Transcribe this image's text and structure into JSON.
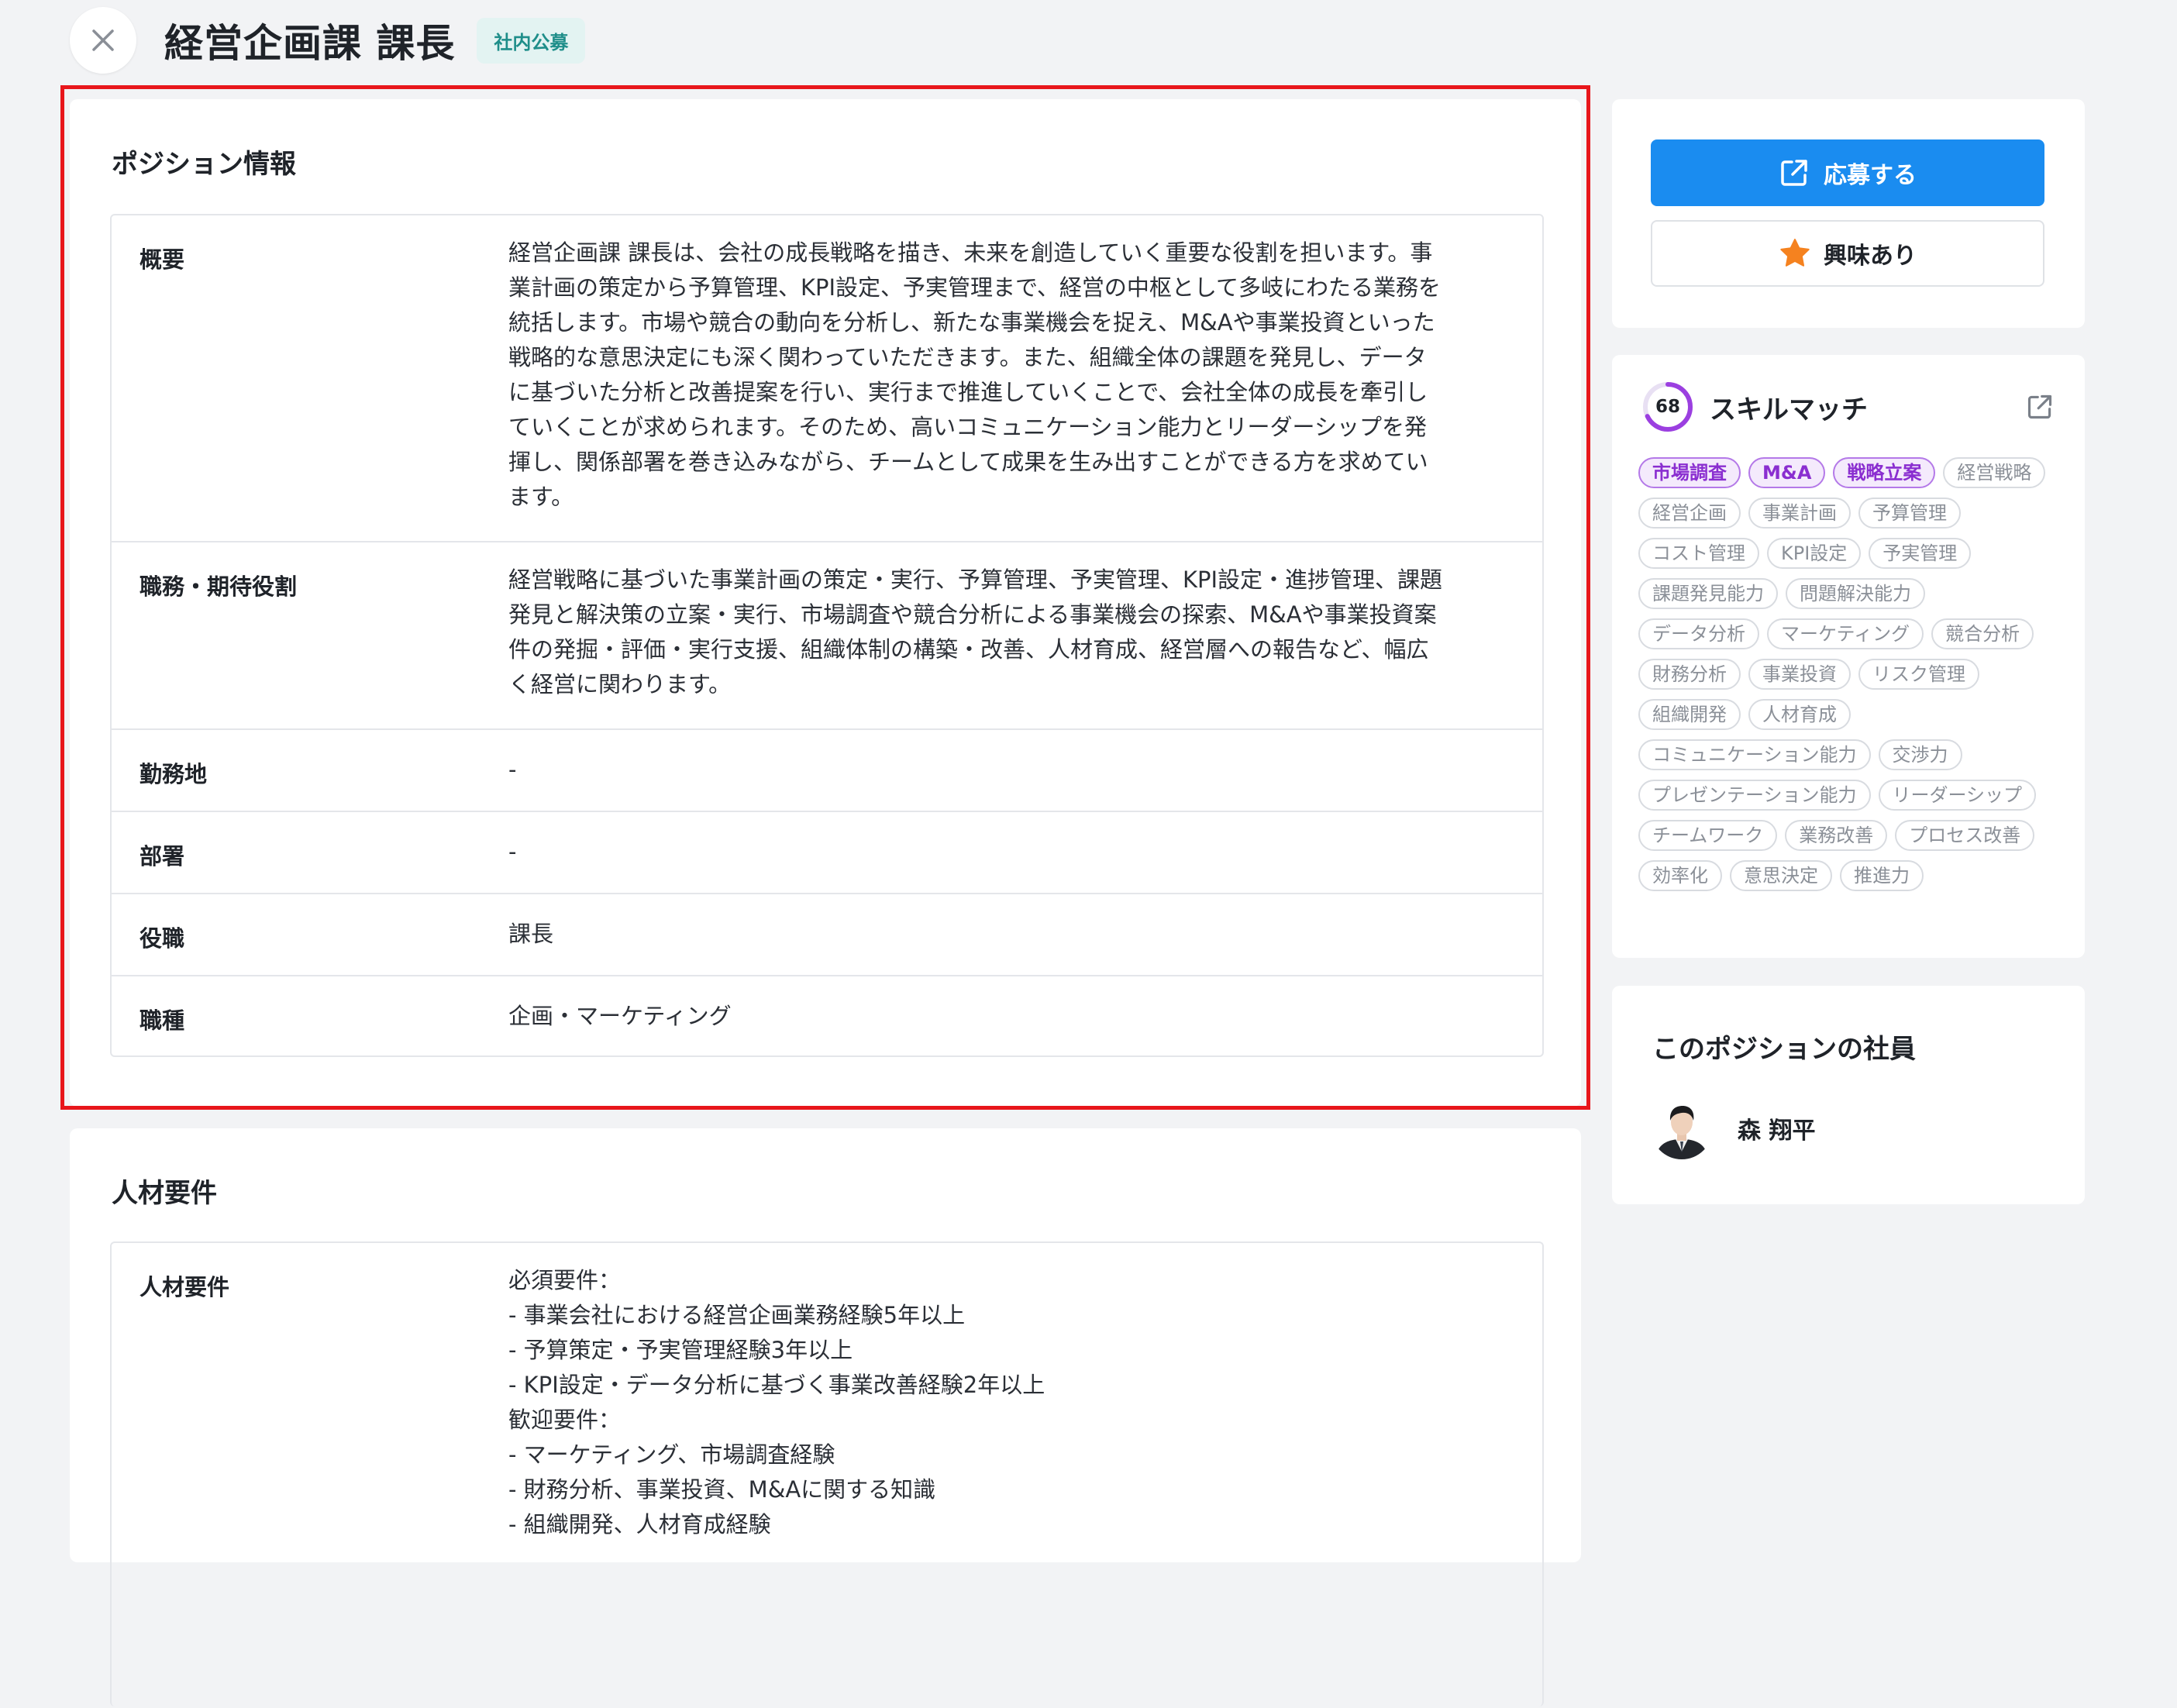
{
  "header": {
    "title": "経営企画課 課長",
    "badge": "社内公募"
  },
  "position_info": {
    "title": "ポジション情報",
    "rows": [
      {
        "label": "概要",
        "value": "経営企画課 課長は、会社の成長戦略を描き、未来を創造していく重要な役割を担います。事\n業計画の策定から予算管理、KPI設定、予実管理まで、経営の中枢として多岐にわたる業務を\n統括します。市場や競合の動向を分析し、新たな事業機会を捉え、M&Aや事業投資といった\n戦略的な意思決定にも深く関わっていただきます。また、組織全体の課題を発見し、データ\nに基づいた分析と改善提案を行い、実行まで推進していくことで、会社全体の成長を牽引し\nていくことが求められます。そのため、高いコミュニケーション能力とリーダーシップを発\n揮し、関係部署を巻き込みながら、チームとして成果を生み出すことができる方を求めてい\nます。"
      },
      {
        "label": "職務・期待役割",
        "value": "経営戦略に基づいた事業計画の策定・実行、予算管理、予実管理、KPI設定・進捗管理、課題\n発見と解決策の立案・実行、市場調査や競合分析による事業機会の探索、M&Aや事業投資案\n件の発掘・評価・実行支援、組織体制の構築・改善、人材育成、経営層への報告など、幅広\nく経営に関わります。"
      },
      {
        "label": "勤務地",
        "value": "-"
      },
      {
        "label": "部署",
        "value": "-"
      },
      {
        "label": "役職",
        "value": "課長"
      },
      {
        "label": "職種",
        "value": "企画・マーケティング"
      }
    ]
  },
  "requirements": {
    "title": "人材要件",
    "rows": [
      {
        "label": "人材要件",
        "value": "必須要件：\n- 事業会社における経営企画業務経験5年以上\n- 予算策定・予実管理経験3年以上\n- KPI設定・データ分析に基づく事業改善経験2年以上\n歓迎要件：\n- マーケティング、市場調査経験\n- 財務分析、事業投資、M&Aに関する知識\n- 組織開発、人材育成経験"
      }
    ]
  },
  "actions": {
    "apply_label": "応募する",
    "interest_label": "興味あり"
  },
  "skill_match": {
    "title": "スキルマッチ",
    "score": 68,
    "matched": [
      "市場調査",
      "M&A",
      "戦略立案"
    ],
    "skills": [
      "経営戦略",
      "経営企画",
      "事業計画",
      "予算管理",
      "コスト管理",
      "KPI設定",
      "予実管理",
      "課題発見能力",
      "問題解決能力",
      "データ分析",
      "マーケティング",
      "競合分析",
      "財務分析",
      "事業投資",
      "リスク管理",
      "組織開発",
      "人材育成",
      "コミュニケーション能力",
      "交渉力",
      "プレゼンテーション能力",
      "リーダーシップ",
      "チームワーク",
      "業務改善",
      "プロセス改善",
      "効率化",
      "意思決定",
      "推進力"
    ]
  },
  "employees": {
    "title": "このポジションの社員",
    "list": [
      {
        "name": "森 翔平"
      }
    ]
  },
  "colors": {
    "primary": "#1a8cf0",
    "highlight_border": "#e8161b",
    "badge_bg": "#e3f3f2",
    "badge_text": "#1f8e8a",
    "match_tag": "#8a2ed0",
    "star": "#f5821f"
  },
  "icons": {
    "close": "close-icon",
    "apply": "external-link-icon",
    "interest": "star-icon",
    "skill_link": "external-link-icon"
  }
}
